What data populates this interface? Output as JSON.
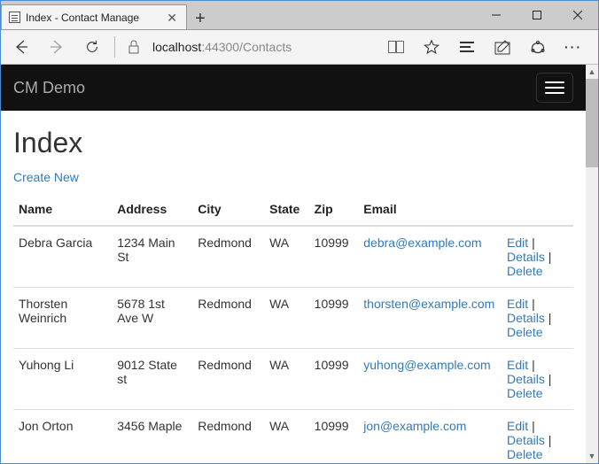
{
  "browser": {
    "tab_title": "Index - Contact Manage",
    "url_host": "localhost",
    "url_rest": ":44300/Contacts"
  },
  "navbar": {
    "brand": "CM Demo"
  },
  "page": {
    "heading": "Index",
    "create_link": "Create New"
  },
  "table": {
    "headers": {
      "name": "Name",
      "address": "Address",
      "city": "City",
      "state": "State",
      "zip": "Zip",
      "email": "Email"
    },
    "action_labels": {
      "edit": "Edit",
      "details": "Details",
      "delete": "Delete"
    },
    "rows": [
      {
        "name": "Debra Garcia",
        "address": "1234 Main St",
        "city": "Redmond",
        "state": "WA",
        "zip": "10999",
        "email": "debra@example.com"
      },
      {
        "name": "Thorsten Weinrich",
        "address": "5678 1st Ave W",
        "city": "Redmond",
        "state": "WA",
        "zip": "10999",
        "email": "thorsten@example.com"
      },
      {
        "name": "Yuhong Li",
        "address": "9012 State st",
        "city": "Redmond",
        "state": "WA",
        "zip": "10999",
        "email": "yuhong@example.com"
      },
      {
        "name": "Jon Orton",
        "address": "3456 Maple",
        "city": "Redmond",
        "state": "WA",
        "zip": "10999",
        "email": "jon@example.com"
      }
    ]
  }
}
